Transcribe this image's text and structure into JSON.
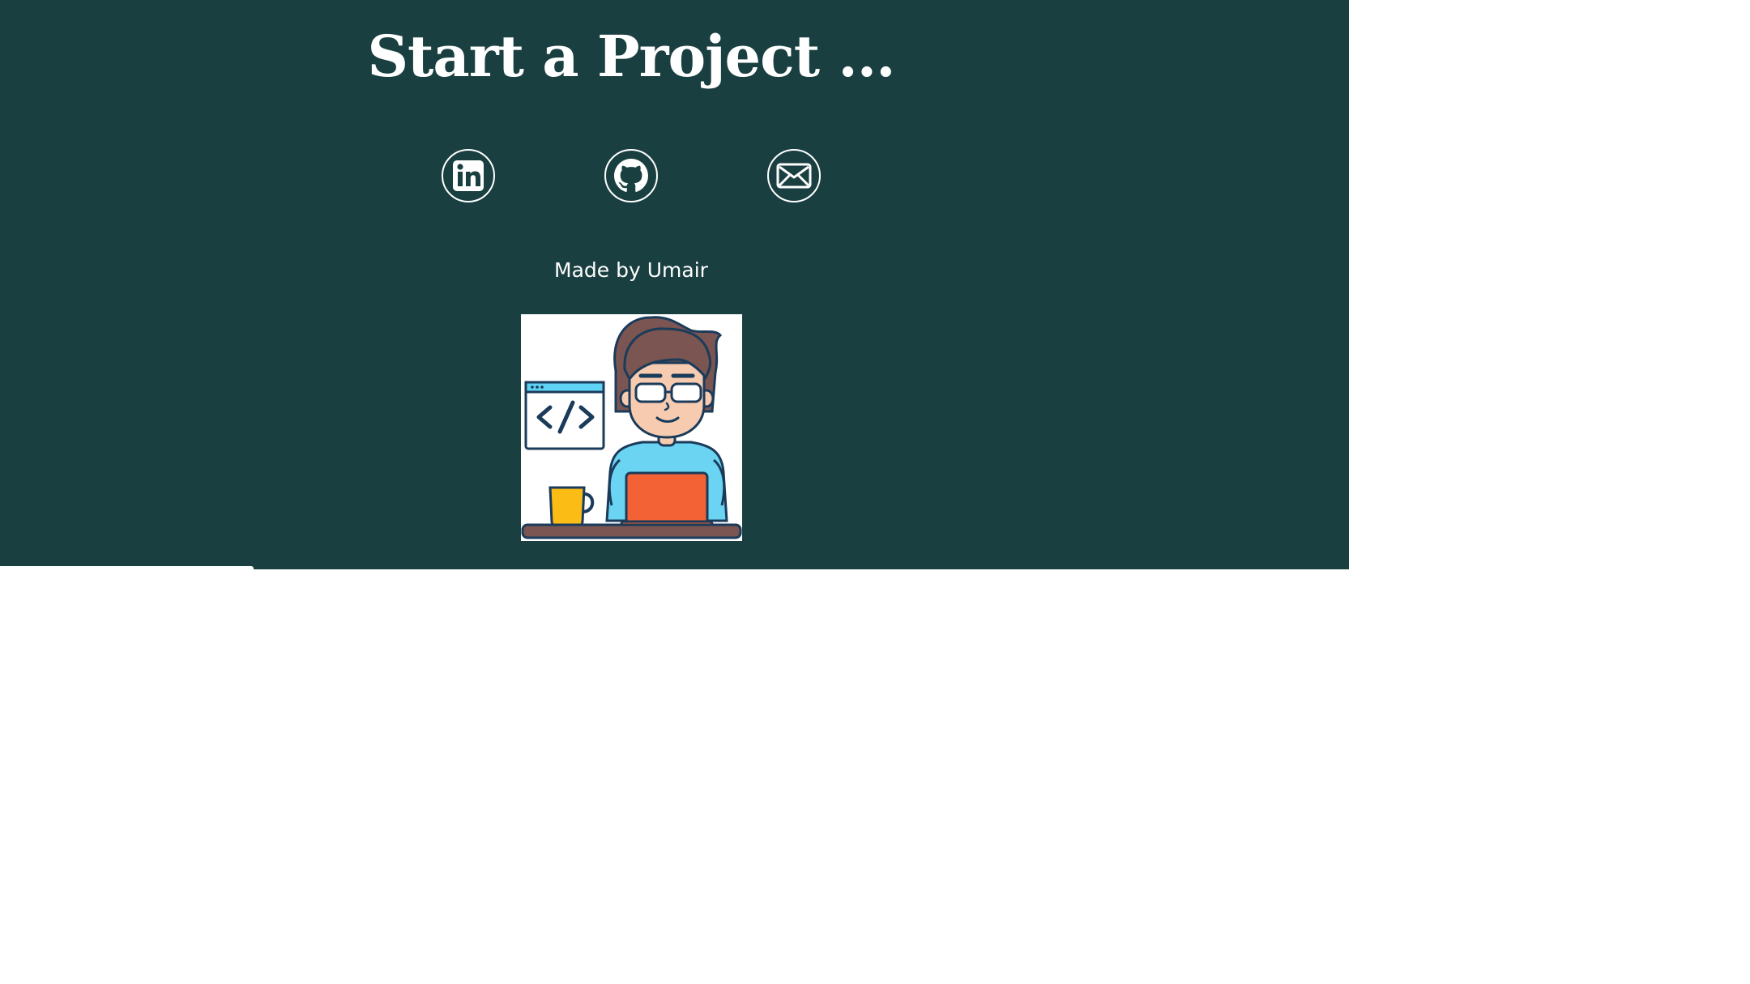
{
  "footer": {
    "heading": "Start a Project ...",
    "social_links": [
      {
        "name": "LinkedIn",
        "icon": "linkedin-icon"
      },
      {
        "name": "GitHub",
        "icon": "github-icon"
      },
      {
        "name": "Email",
        "icon": "email-icon"
      }
    ],
    "credit": "Made by Umair",
    "illustration": "developer-at-laptop-illustration"
  },
  "colors": {
    "background": "#1a3f40",
    "text": "#ffffff",
    "page": "#ffffff"
  }
}
